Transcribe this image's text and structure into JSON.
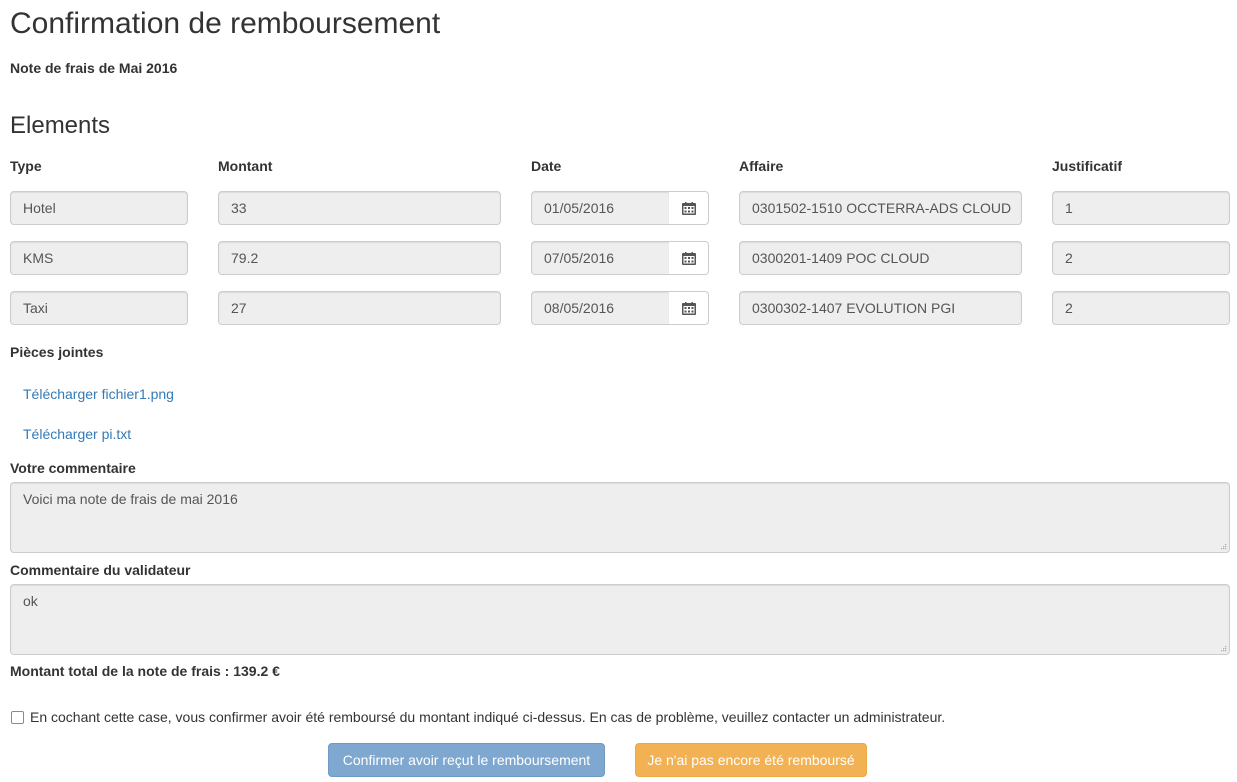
{
  "page": {
    "title": "Confirmation de remboursement",
    "subtitle": "Note de frais de Mai 2016"
  },
  "elements": {
    "heading": "Elements",
    "columns": {
      "type": "Type",
      "amount": "Montant",
      "date": "Date",
      "project": "Affaire",
      "receipt": "Justificatif"
    },
    "rows": [
      {
        "type": "Hotel",
        "amount": "33",
        "date": "01/05/2016",
        "project": "0301502-1510 OCCTERRA-ADS CLOUD",
        "receipt": "1"
      },
      {
        "type": "KMS",
        "amount": "79.2",
        "date": "07/05/2016",
        "project": "0300201-1409 POC CLOUD",
        "receipt": "2"
      },
      {
        "type": "Taxi",
        "amount": "27",
        "date": "08/05/2016",
        "project": "0300302-1407 EVOLUTION PGI",
        "receipt": "2"
      }
    ],
    "calendar_icon": "calendar-icon"
  },
  "attachments": {
    "label": "Pièces jointes",
    "links": [
      "Télécharger fichier1.png",
      "Télécharger pi.txt"
    ]
  },
  "comments": {
    "user_label": "Votre commentaire",
    "user_value": "Voici ma note de frais de mai 2016",
    "validator_label": "Commentaire du validateur",
    "validator_value": "ok"
  },
  "total": {
    "text": "Montant total de la note de frais : 139.2 €"
  },
  "confirmation": {
    "checkbox_checked": false,
    "checkbox_text": "En cochant cette case, vous confirmer avoir été remboursé du montant indiqué ci-dessus. En cas de problème, veuillez contacter un administrateur.",
    "confirm_button": "Confirmer avoir reçut le remboursement",
    "not_reimbursed_button": "Je n'ai pas encore été remboursé"
  },
  "colors": {
    "link": "#337ab7",
    "primary_button": "#7fa8d0",
    "warning_button": "#f2b153",
    "field_background": "#eeeeee"
  }
}
